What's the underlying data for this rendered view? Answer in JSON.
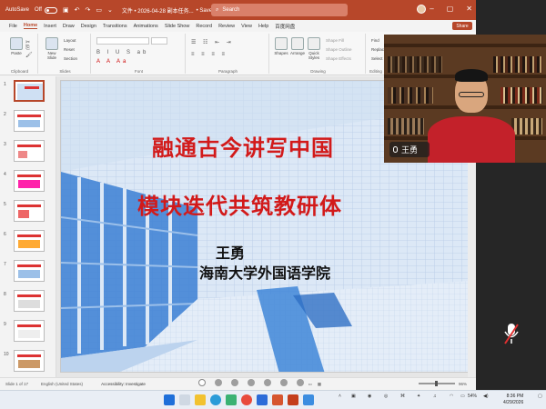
{
  "titlebar": {
    "autosave_label": "AutoSave",
    "autosave_state": "Off",
    "doc_title": "文件 • 2026-04-28 副本任务...",
    "saved_status": "• Saved to this PC ⌄",
    "search_placeholder": "Search"
  },
  "menu": {
    "tabs": [
      "File",
      "Home",
      "Insert",
      "Draw",
      "Design",
      "Transitions",
      "Animations",
      "Slide Show",
      "Record",
      "Review",
      "View",
      "Help",
      "百度网盘"
    ],
    "active": "Home",
    "share_label": "Share"
  },
  "ribbon": {
    "groups": [
      "Clipboard",
      "Slides",
      "Font",
      "Paragraph",
      "Drawing",
      "Editing"
    ],
    "paste": "Paste",
    "new_slide": "New Slide",
    "layout": "Layout",
    "reset": "Reset",
    "section": "Section",
    "shapes": "Shapes",
    "arrange": "Arrange",
    "quick_styles": "Quick Styles",
    "shape_fill": "Shape Fill",
    "shape_outline": "Shape Outline",
    "shape_effects": "Shape Effects",
    "find": "Find",
    "replace": "Replace",
    "select": "Select"
  },
  "thumbnails": {
    "numbers": [
      "1",
      "2",
      "3",
      "4",
      "5",
      "6",
      "7",
      "8",
      "9",
      "10"
    ],
    "selected_index": 0
  },
  "slide": {
    "title_line1": "融通古今讲写中国",
    "title_line2": "模块迭代共筑教研体",
    "author": "王勇",
    "institution": "海南大学外国语学院"
  },
  "statusbar": {
    "slide_count": "Slide 1 of 17",
    "language": "English (United States)",
    "accessibility": "Accessibility: Investigate",
    "zoom": "96%"
  },
  "video": {
    "participant_name": "王勇"
  },
  "taskbar": {
    "time": "8:36 PM",
    "date": "4/29/2026",
    "battery": "54%"
  },
  "colors": {
    "accent": "#b7472a",
    "slide_title": "#d21a1a"
  }
}
